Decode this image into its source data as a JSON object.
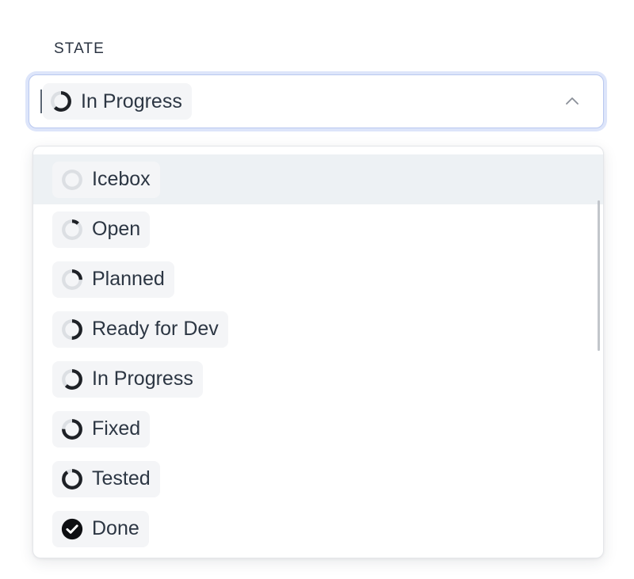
{
  "field": {
    "label": "STATE",
    "selected": {
      "label": "In Progress",
      "icon": "progress-ring-icon",
      "progress": 62
    },
    "caret_visible": true,
    "expand_icon": "chevron-up-icon",
    "expanded": true
  },
  "dropdown": {
    "highlighted_index": 0,
    "scrollbar": "vertical-scrollbar",
    "options": [
      {
        "label": "Icebox",
        "icon": "progress-ring-icon",
        "progress": 0
      },
      {
        "label": "Open",
        "icon": "progress-ring-icon",
        "progress": 12
      },
      {
        "label": "Planned",
        "icon": "progress-ring-icon",
        "progress": 25
      },
      {
        "label": "Ready for Dev",
        "icon": "progress-ring-icon",
        "progress": 50
      },
      {
        "label": "In Progress",
        "icon": "progress-ring-icon",
        "progress": 62
      },
      {
        "label": "Fixed",
        "icon": "progress-ring-icon",
        "progress": 75
      },
      {
        "label": "Tested",
        "icon": "progress-ring-icon",
        "progress": 90
      },
      {
        "label": "Done",
        "icon": "check-circle-filled-icon",
        "progress": 100
      }
    ]
  },
  "colors": {
    "focus_ring": "#dde5fa",
    "focus_border": "#b9c8ef",
    "chip_background": "#f4f5f7",
    "highlight_row": "#edf1f4",
    "text": "#2c3643",
    "ring_track": "#dcdfe3",
    "ring_fill": "#1e2126",
    "panel_border": "#e4e6e9"
  }
}
